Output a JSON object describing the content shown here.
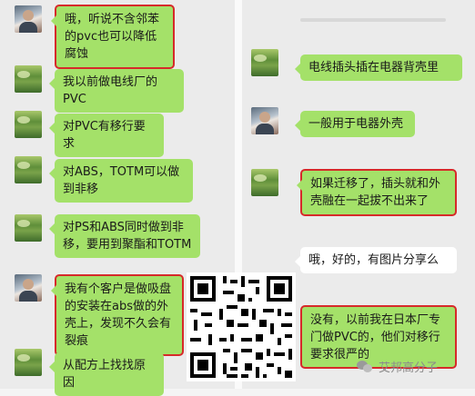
{
  "left_messages": [
    {
      "avatar": "person-avatar",
      "text": "哦，听说不含邻苯的pvc也可以降低腐蚀",
      "highlighted": true
    },
    {
      "avatar": "landscape-avatar",
      "text": "我以前做电线厂的PVC",
      "highlighted": false
    },
    {
      "avatar": "landscape-avatar",
      "text": "对PVC有移行要求",
      "highlighted": false
    },
    {
      "avatar": "landscape-avatar",
      "text": "对ABS，TOTM可以做到非移",
      "highlighted": false
    },
    {
      "avatar": "landscape-avatar",
      "text": "对PS和ABS同时做到非移，要用到聚酯和TOTM",
      "highlighted": false
    },
    {
      "avatar": "person-avatar",
      "text": "我有个客户是做吸盘的安装在abs做的外壳上，发现不久会有裂痕",
      "highlighted": true
    },
    {
      "avatar": "landscape-avatar",
      "text": "从配方上找找原因",
      "highlighted": false
    }
  ],
  "right_messages": [
    {
      "avatar": "landscape-avatar",
      "text": "电线插头插在电器背壳里",
      "highlighted": false
    },
    {
      "avatar": "person-avatar",
      "text": "一般用于电器外壳",
      "highlighted": false
    },
    {
      "avatar": "landscape-avatar",
      "text": "如果迁移了，插头就和外壳融在一起拔不出来了",
      "highlighted": true
    },
    {
      "avatar": "none",
      "text": "哦，好的，有图片分享么",
      "highlighted": false,
      "bubble_color": "white"
    },
    {
      "avatar": "none",
      "text": "没有，以前我在日本厂专门做PVC的，他们对移行要求很严的",
      "highlighted": true
    }
  ],
  "watermark": {
    "text": "艾邦高分子",
    "icon": "wechat-icon"
  },
  "qr_code": {
    "icon": "qr-code"
  },
  "colors": {
    "bubble_green": "#a4e169",
    "highlight_red": "#d62a2a",
    "background": "#ebebeb"
  }
}
